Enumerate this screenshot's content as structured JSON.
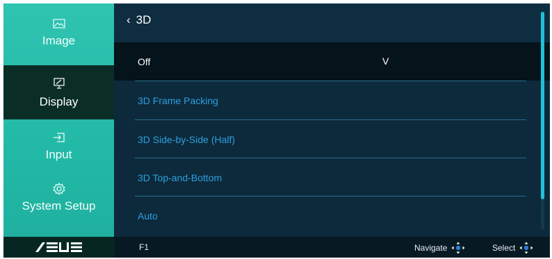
{
  "sidebar": {
    "items": [
      {
        "label": "Image",
        "icon": "image-icon"
      },
      {
        "label": "Display",
        "icon": "display-icon",
        "active": true
      },
      {
        "label": "Input",
        "icon": "input-icon"
      },
      {
        "label": "System Setup",
        "icon": "gear-icon"
      }
    ],
    "brand": "/ISUS"
  },
  "header": {
    "title": "3D",
    "back_icon": "chevron-left-icon"
  },
  "options": [
    {
      "label": "Off",
      "selected": true
    },
    {
      "label": "3D Frame Packing"
    },
    {
      "label": "3D Side-by-Side (Half)"
    },
    {
      "label": "3D Top-and-Bottom"
    },
    {
      "label": "Auto"
    }
  ],
  "selected_mark": "V",
  "footer": {
    "f1": "F1",
    "navigate_label": "Navigate",
    "select_label": "Select"
  },
  "colors": {
    "sidebar": "#22b8a6",
    "active_item": "#0a2e26",
    "main_bg": "#0c2a3b",
    "option_text": "#2e9fe0",
    "scroll_thumb": "#1fc2d8"
  }
}
